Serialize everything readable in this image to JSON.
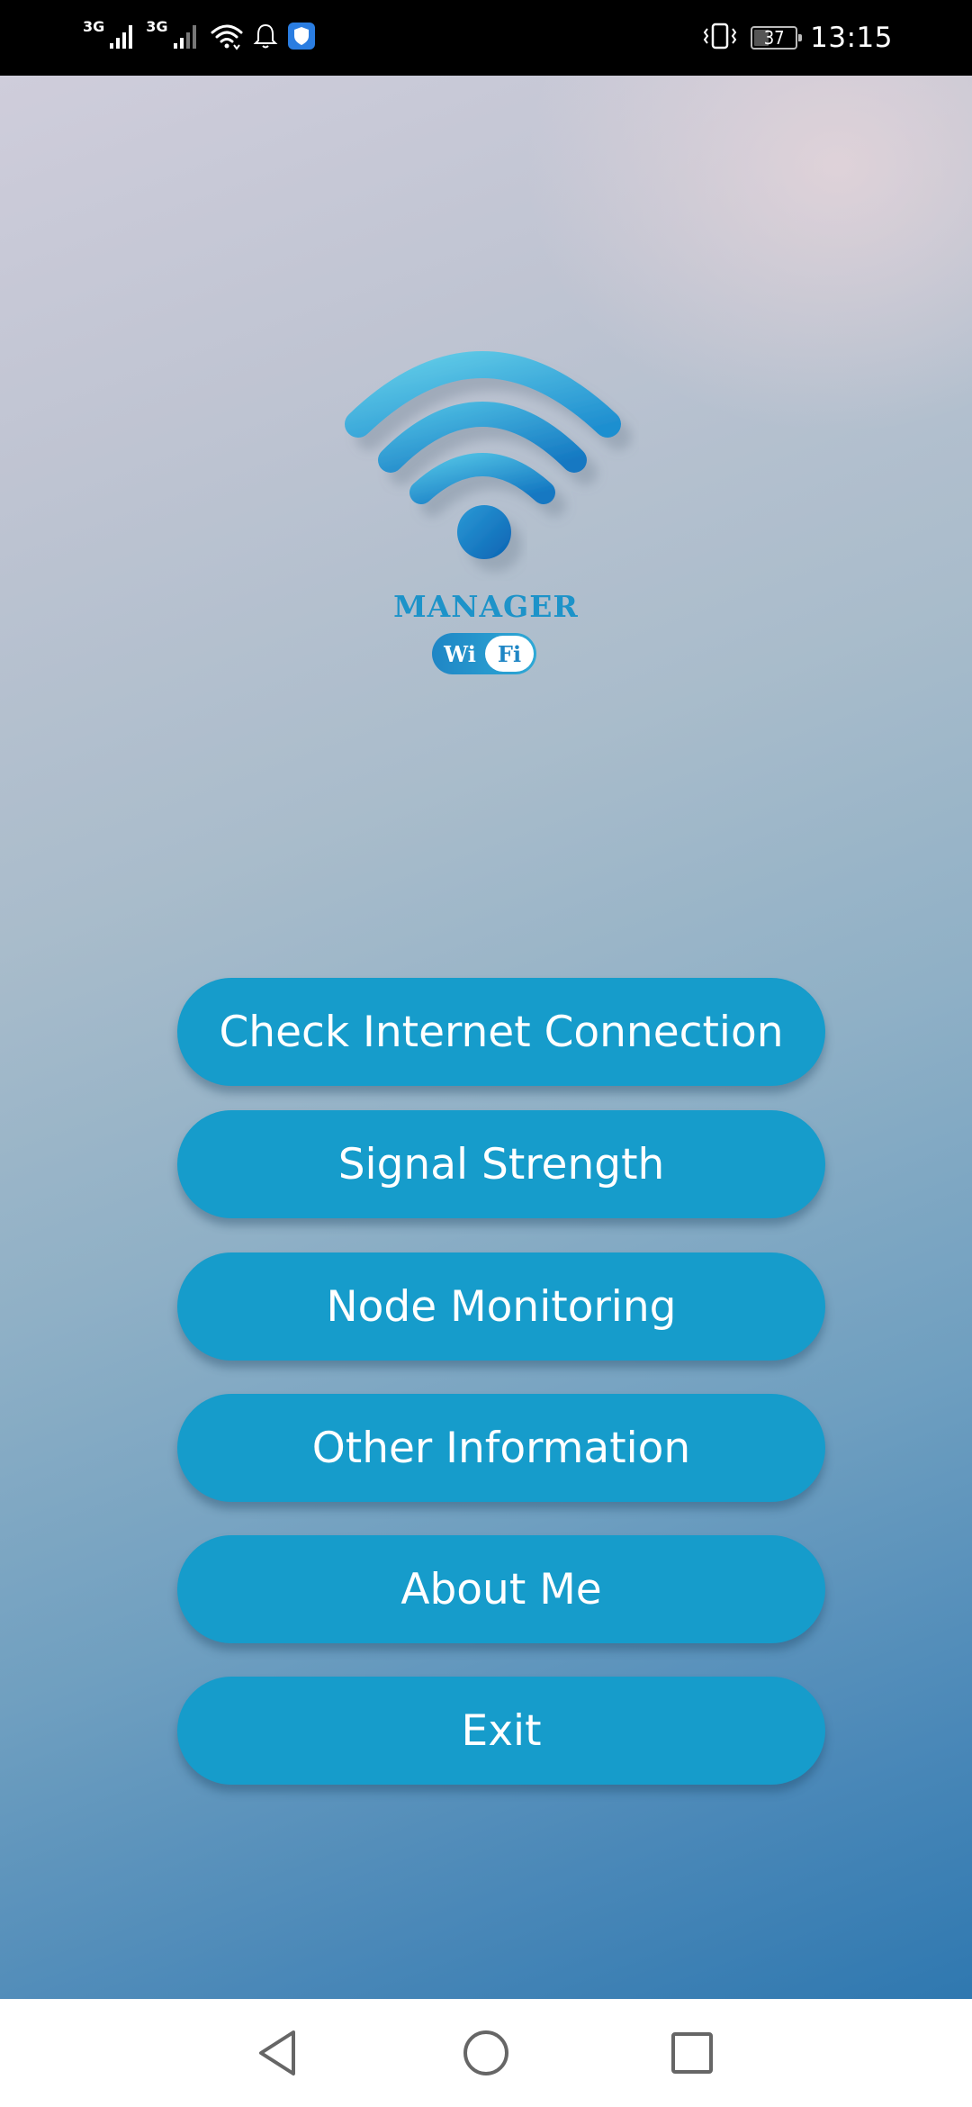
{
  "status_bar": {
    "network_type_1": "3G",
    "network_type_2": "3G",
    "battery_level": "37",
    "time": "13:15",
    "icons": [
      "signal-icon",
      "signal-icon",
      "wifi-icon",
      "bell-icon",
      "shield-icon",
      "vibrate-icon",
      "battery-icon"
    ]
  },
  "logo": {
    "title": "MANAGER",
    "badge_left": "Wi",
    "badge_right": "Fi",
    "colors": {
      "arc_light": "#5cc8e6",
      "arc_dark": "#0e74bd",
      "text": "#1d93c9"
    }
  },
  "menu": {
    "button_color": "#169ccb",
    "items": [
      {
        "label": "Check Internet Connection"
      },
      {
        "label": "Signal Strength"
      },
      {
        "label": "Node Monitoring"
      },
      {
        "label": "Other Information"
      },
      {
        "label": "About Me"
      },
      {
        "label": "Exit"
      }
    ]
  },
  "nav_bar": {
    "icons": [
      "back-icon",
      "home-icon",
      "recents-icon"
    ]
  }
}
